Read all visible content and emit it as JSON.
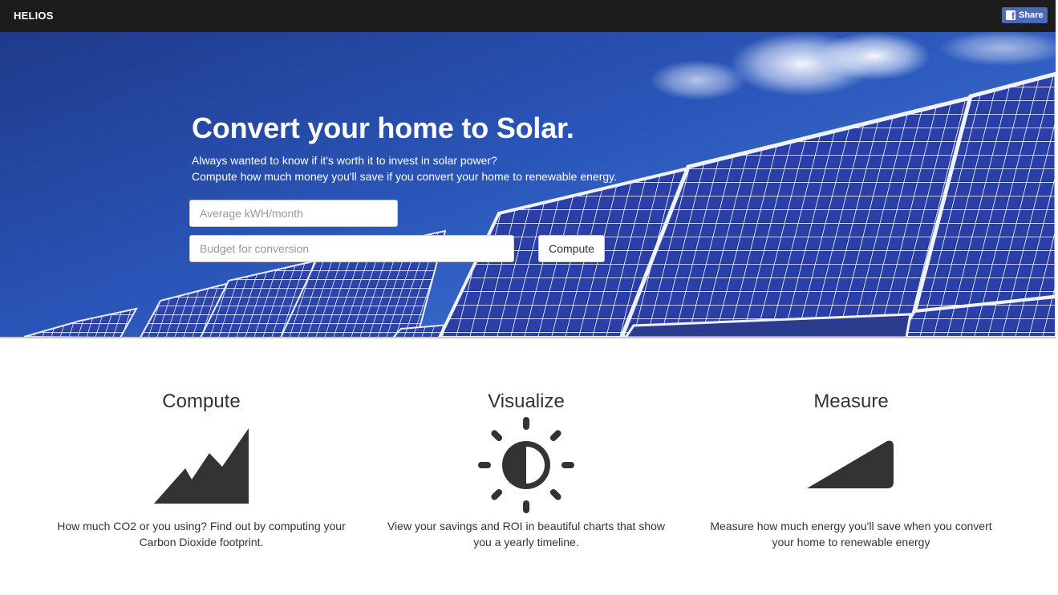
{
  "navbar": {
    "brand": "HELIOS",
    "share_label": "Share",
    "share_icon": "facebook-icon"
  },
  "hero": {
    "title": "Convert your home to Solar.",
    "subtitle_line1": "Always wanted to know if it's worth it to invest in solar power?",
    "subtitle_line2": "Compute how much money you'll save if you convert your home to renewable energy.",
    "kwh_placeholder": "Average kWH/month",
    "budget_placeholder": "Budget for conversion",
    "compute_label": "Compute",
    "background": "solar-panels-sky-photo"
  },
  "features": [
    {
      "title": "Compute",
      "icon": "area-chart-icon",
      "line1": "How much CO2 or you using? Find out by computing your",
      "line2": "Carbon Dioxide footprint."
    },
    {
      "title": "Visualize",
      "icon": "brightness-sun-icon",
      "line1": "View your savings and ROI in beautiful charts that show",
      "line2": "you a yearly timeline."
    },
    {
      "title": "Measure",
      "icon": "signal-wedge-icon",
      "line1": "Measure how much energy you'll save when you convert",
      "line2": "your home to renewable energy"
    }
  ],
  "colors": {
    "navbar_bg": "#1c1c1c",
    "facebook_blue": "#4c69ba",
    "sky_blue": "#2a55b8",
    "icon_dark": "#333333"
  }
}
